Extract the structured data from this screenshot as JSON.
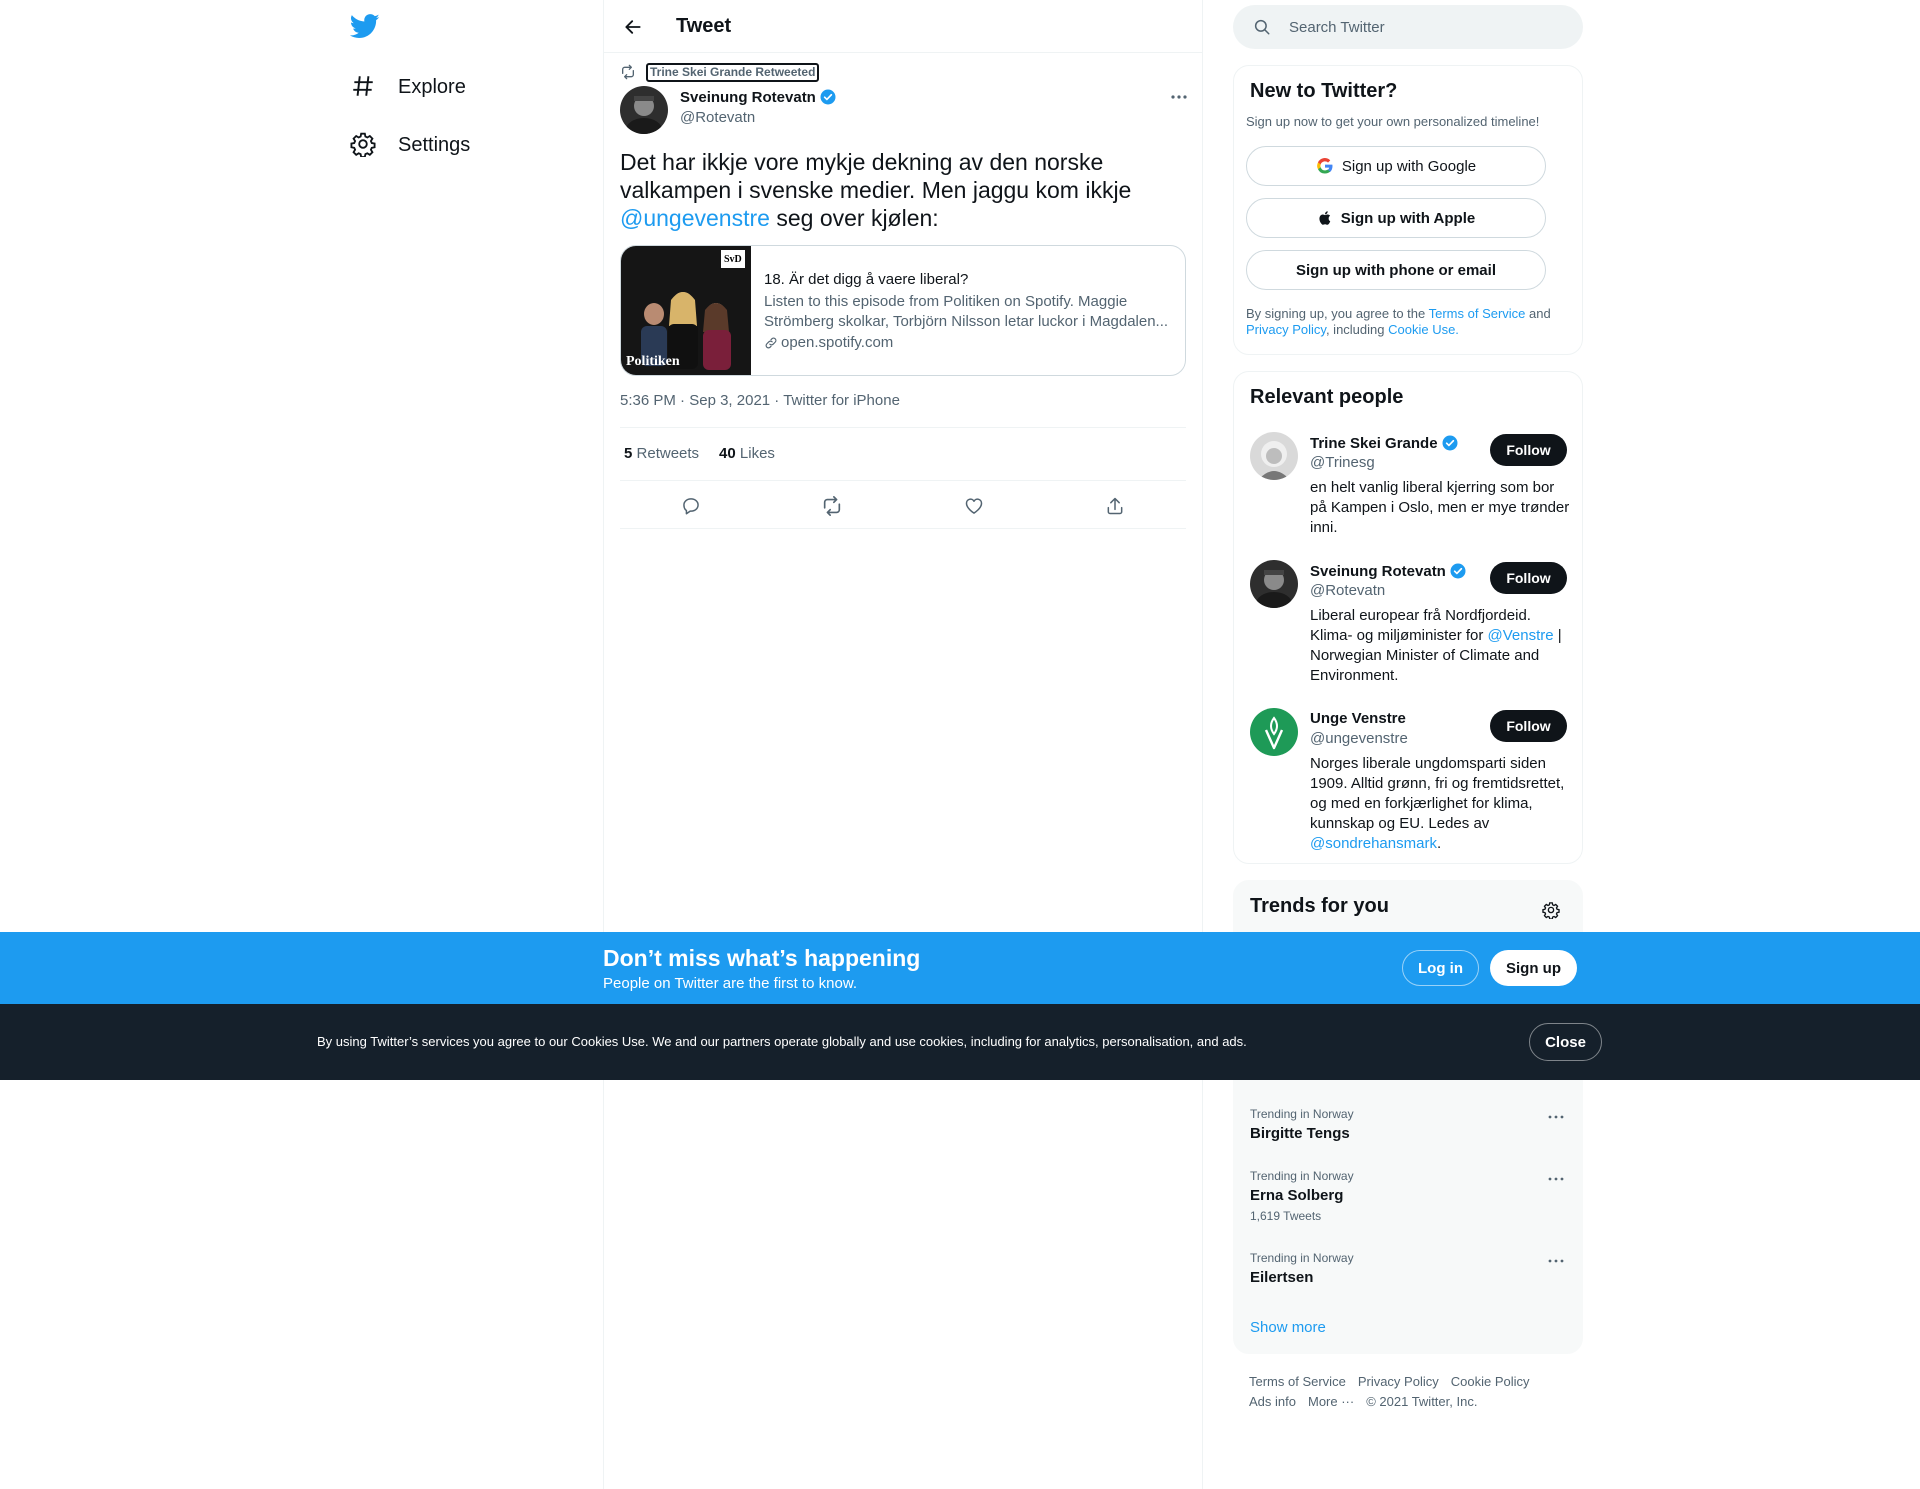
{
  "nav": {
    "logo": "twitter-bird-icon",
    "items": [
      {
        "label": "Explore",
        "icon": "hashtag-icon"
      },
      {
        "label": "Settings",
        "icon": "gear-icon"
      }
    ]
  },
  "header": {
    "title": "Tweet"
  },
  "tweet": {
    "retweeted_by": "Trine Skei Grande Retweeted",
    "author_name": "Sveinung Rotevatn",
    "author_handle": "@Rotevatn",
    "text_part1": "Det har ikkje vore mykje dekning av den norske valkampen i svenske medier. Men jaggu kom ikkje ",
    "text_mention": "@ungevenstre",
    "text_part2": " seg over kjølen:",
    "card": {
      "image_label": "Politiken",
      "image_badge": "SvD",
      "title": "18. Är det digg å vaere liberal?",
      "description": "Listen to this episode from Politiken on Spotify. Maggie Strömberg skolkar, Torbjörn Nilsson letar luckor i Magdalen...",
      "domain": "open.spotify.com"
    },
    "time": "5:36 PM",
    "date": "Sep 3, 2021",
    "source": "Twitter for iPhone",
    "retweets": "5",
    "retweets_label": "Retweets",
    "likes": "40",
    "likes_label": "Likes"
  },
  "search": {
    "placeholder": "Search Twitter"
  },
  "new_to_twitter": {
    "title": "New to Twitter?",
    "subtitle": "Sign up now to get your own personalized timeline!",
    "google": "Sign up with Google",
    "apple": "Sign up with Apple",
    "phone": "Sign up with phone or email",
    "legal_1": "By signing up, you agree to the ",
    "tos": "Terms of Service",
    "legal_2": " and ",
    "privacy": "Privacy Policy",
    "legal_3": ", including ",
    "cookie": "Cookie Use."
  },
  "relevant_people": {
    "title": "Relevant people",
    "follow_label": "Follow",
    "people": [
      {
        "name": "Trine Skei Grande",
        "handle": "@Trinesg",
        "bio": "en helt vanlig liberal kjerring som bor på Kampen i Oslo, men er mye trønder inni."
      },
      {
        "name": "Sveinung Rotevatn",
        "handle": "@Rotevatn",
        "bio_1": "Liberal europear frå Nordfjordeid. Klima- og miljøminister for ",
        "bio_mention": "@Venstre",
        "bio_2": " | Norwegian Minister of Climate and Environment."
      },
      {
        "name": "Unge Venstre",
        "handle": "@ungevenstre",
        "bio_1": "Norges liberale ungdomsparti siden 1909. Alltid grønn, fri og fremtidsrettet, og med en forkjærlighet for klima, kunnskap og EU. Ledes av ",
        "bio_mention": "@sondrehansmark",
        "bio_2": "."
      }
    ]
  },
  "trends": {
    "title": "Trends for you",
    "items": [
      {
        "context": "Trending in Norway",
        "name": "Birgitte Tengs",
        "count": ""
      },
      {
        "context": "Trending in Norway",
        "name": "Erna Solberg",
        "count": "1,619 Tweets"
      },
      {
        "context": "Trending in Norway",
        "name": "Eilertsen",
        "count": ""
      }
    ],
    "show_more": "Show more"
  },
  "footer": {
    "links": [
      "Terms of Service",
      "Privacy Policy",
      "Cookie Policy",
      "Ads info",
      "More ···"
    ],
    "copyright": "© 2021 Twitter, Inc."
  },
  "bottom_bar": {
    "title": "Don’t miss what’s happening",
    "subtitle": "People on Twitter are the first to know.",
    "login": "Log in",
    "signup": "Sign up"
  },
  "cookie_bar": {
    "text": "By using Twitter’s services you agree to our Cookies Use. We and our partners operate globally and use cookies, including for analytics, personalisation, and ads.",
    "close": "Close"
  },
  "colors": {
    "accent": "#1d9bf0",
    "text": "#0f1419",
    "secondary": "#536471",
    "cookie_bar": "#15202b"
  }
}
